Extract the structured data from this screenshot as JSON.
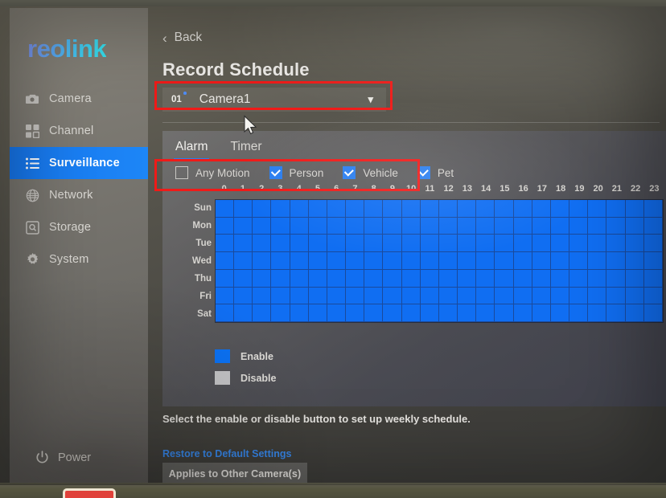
{
  "sidebar": {
    "logo": "reolink",
    "items": [
      {
        "label": "Camera",
        "icon": "camera-icon",
        "active": false
      },
      {
        "label": "Channel",
        "icon": "channel-grid-icon",
        "active": false
      },
      {
        "label": "Surveillance",
        "icon": "list-icon",
        "active": true
      },
      {
        "label": "Network",
        "icon": "globe-icon",
        "active": false
      },
      {
        "label": "Storage",
        "icon": "disk-icon",
        "active": false
      },
      {
        "label": "System",
        "icon": "gear-icon",
        "active": false
      }
    ],
    "power_label": "Power",
    "power_icon": "power-icon"
  },
  "header": {
    "back_label": "Back",
    "back_icon": "chevron-left-icon",
    "title": "Record Schedule"
  },
  "camera_select": {
    "number": "01",
    "name": "Camera1",
    "chevron_icon": "chevron-down-icon"
  },
  "tabs": [
    {
      "label": "Alarm",
      "active": true
    },
    {
      "label": "Timer",
      "active": false
    }
  ],
  "detection_types": [
    {
      "label": "Any Motion",
      "checked": false
    },
    {
      "label": "Person",
      "checked": true
    },
    {
      "label": "Vehicle",
      "checked": true
    },
    {
      "label": "Pet",
      "checked": true
    }
  ],
  "schedule": {
    "hours": [
      "0",
      "1",
      "2",
      "3",
      "4",
      "5",
      "6",
      "7",
      "8",
      "9",
      "10",
      "11",
      "12",
      "13",
      "14",
      "15",
      "16",
      "17",
      "18",
      "19",
      "20",
      "21",
      "22",
      "23"
    ],
    "days": [
      "Sun",
      "Mon",
      "Tue",
      "Wed",
      "Thu",
      "Fri",
      "Sat"
    ],
    "cells": [
      [
        1,
        1,
        1,
        1,
        1,
        1,
        1,
        1,
        1,
        1,
        1,
        1,
        1,
        1,
        1,
        1,
        1,
        1,
        1,
        1,
        1,
        1,
        1,
        1
      ],
      [
        1,
        1,
        1,
        1,
        1,
        1,
        1,
        1,
        1,
        1,
        1,
        1,
        1,
        1,
        1,
        1,
        1,
        1,
        1,
        1,
        1,
        1,
        1,
        1
      ],
      [
        1,
        1,
        1,
        1,
        1,
        1,
        1,
        1,
        1,
        1,
        1,
        1,
        1,
        1,
        1,
        1,
        1,
        1,
        1,
        1,
        1,
        1,
        1,
        1
      ],
      [
        1,
        1,
        1,
        1,
        1,
        1,
        1,
        1,
        1,
        1,
        1,
        1,
        1,
        1,
        1,
        1,
        1,
        1,
        1,
        1,
        1,
        1,
        1,
        1
      ],
      [
        1,
        1,
        1,
        1,
        1,
        1,
        1,
        1,
        1,
        1,
        1,
        1,
        1,
        1,
        1,
        1,
        1,
        1,
        1,
        1,
        1,
        1,
        1,
        1
      ],
      [
        1,
        1,
        1,
        1,
        1,
        1,
        1,
        1,
        1,
        1,
        1,
        1,
        1,
        1,
        1,
        1,
        1,
        1,
        1,
        1,
        1,
        1,
        1,
        1
      ],
      [
        1,
        1,
        1,
        1,
        1,
        1,
        1,
        1,
        1,
        1,
        1,
        1,
        1,
        1,
        1,
        1,
        1,
        1,
        1,
        1,
        1,
        1,
        1,
        1
      ]
    ]
  },
  "legend": [
    {
      "label": "Enable",
      "color": "#0b72f5"
    },
    {
      "label": "Disable",
      "color": "#c5c5c7"
    }
  ],
  "footer": {
    "hint": "Select the enable or disable button to set up weekly schedule.",
    "restore_label": "Restore to Default Settings",
    "applies_label": "Applies to Other Camera(s)"
  },
  "colors": {
    "accent_blue": "#1677ee",
    "enable_blue": "#0b72f5",
    "disable_gray": "#c5c5c7",
    "annotation_red": "#f01a18",
    "link_blue": "#3a8ef6"
  },
  "annotations": [
    {
      "name": "camera-selector-highlight",
      "color": "#f01a18"
    },
    {
      "name": "detection-types-highlight",
      "color": "#f01a18"
    }
  ]
}
